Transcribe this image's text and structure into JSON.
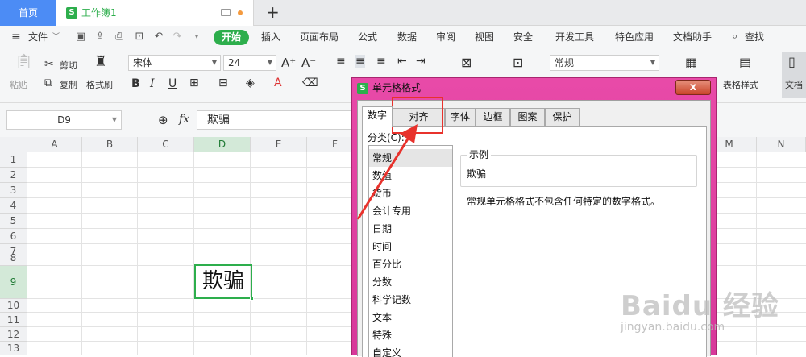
{
  "tabs": {
    "home": "首页",
    "workbook": "工作簿1",
    "workbook_icon": "S"
  },
  "menu": {
    "file": "文件",
    "items": [
      "开始",
      "插入",
      "页面布局",
      "公式",
      "数据",
      "审阅",
      "视图",
      "安全",
      "开发工具",
      "特色应用",
      "文档助手"
    ],
    "search": "查找"
  },
  "ribbon": {
    "paste": "粘贴",
    "cut": "剪切",
    "copy": "复制",
    "format_painter": "格式刷",
    "font_name": "宋体",
    "font_size": "24",
    "number_format": "常规",
    "table_style": "表格样式",
    "doc_label": "文档"
  },
  "formula_bar": {
    "name_box": "D9",
    "fx": "fx",
    "content": "欺骗"
  },
  "sheet": {
    "columns": [
      "A",
      "B",
      "C",
      "D",
      "E",
      "F",
      "M",
      "N"
    ],
    "rows": [
      "1",
      "2",
      "3",
      "4",
      "5",
      "6",
      "7",
      "8",
      "9",
      "10",
      "11",
      "12",
      "13"
    ],
    "active_cell_value": "欺骗"
  },
  "dialog": {
    "title": "单元格格式",
    "close": "x",
    "tabs": [
      "数字",
      "对齐",
      "字体",
      "边框",
      "图案",
      "保护"
    ],
    "category_label": "分类(C):",
    "categories": [
      "常规",
      "数值",
      "货币",
      "会计专用",
      "日期",
      "时间",
      "百分比",
      "分数",
      "科学记数",
      "文本",
      "特殊",
      "自定义"
    ],
    "sample_label": "示例",
    "sample_value": "欺骗",
    "description": "常规单元格格式不包含任何特定的数字格式。"
  },
  "watermark": {
    "main": "Baidu 经验",
    "sub": "jingyan.baidu.com"
  },
  "colors": {
    "accent_green": "#2dae4c",
    "home_tab_blue": "#4c8cf5",
    "dialog_frame": "#e84aa8",
    "annotation_red": "#e8322c"
  }
}
